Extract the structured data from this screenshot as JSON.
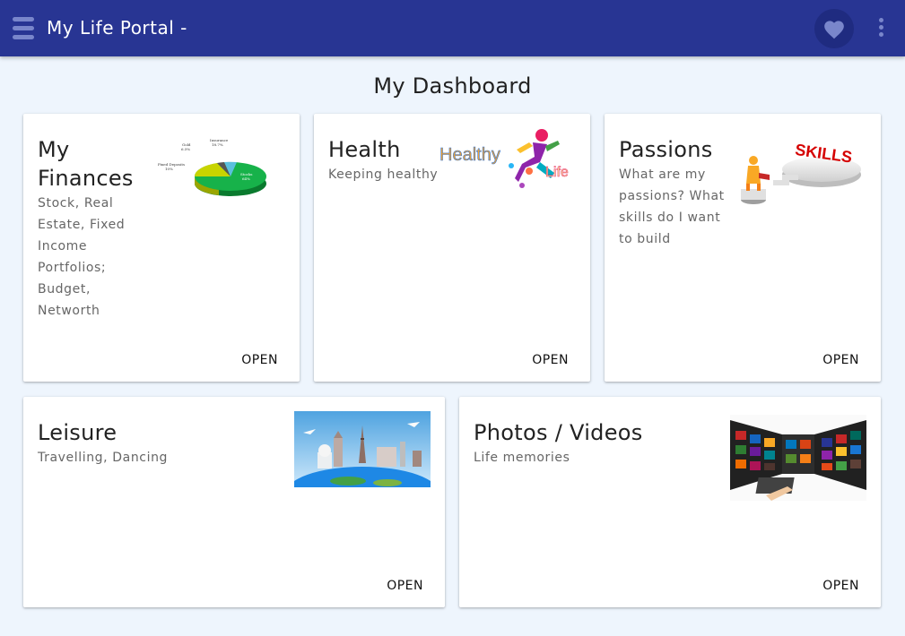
{
  "appbar": {
    "title": "My Life Portal -",
    "menu_icon": "hamburger-menu-icon",
    "favorite_icon": "heart-icon",
    "more_icon": "more-vert-icon",
    "accent_color": "#283593"
  },
  "dashboard": {
    "title": "My Dashboard"
  },
  "cards": {
    "finances": {
      "title": "My Finances",
      "subtitle": "Stock, Real Estate, Fixed Income Portfolios; Budget, Networth",
      "action": "OPEN",
      "chart_labels": {
        "stocks": "Stocks",
        "stocks_pct": "64%",
        "fixed": "Fixed Deposits",
        "fixed_pct": "10%",
        "gold": "Gold",
        "gold_pct": "6.5%",
        "insurance": "Insurance",
        "insurance_pct": "18.7%"
      }
    },
    "health": {
      "title": "Health",
      "subtitle": "Keeping healthy",
      "action": "OPEN",
      "image_text_1": "Healthy",
      "image_text_2": "Life"
    },
    "passions": {
      "title": "Passions",
      "subtitle": "What are my passions? What skills do I want to build",
      "action": "OPEN",
      "image_text": "SKILLS"
    },
    "leisure": {
      "title": "Leisure",
      "subtitle": "Travelling, Dancing",
      "action": "OPEN"
    },
    "photos": {
      "title": "Photos / Videos",
      "subtitle": "Life memories",
      "action": "OPEN"
    }
  }
}
